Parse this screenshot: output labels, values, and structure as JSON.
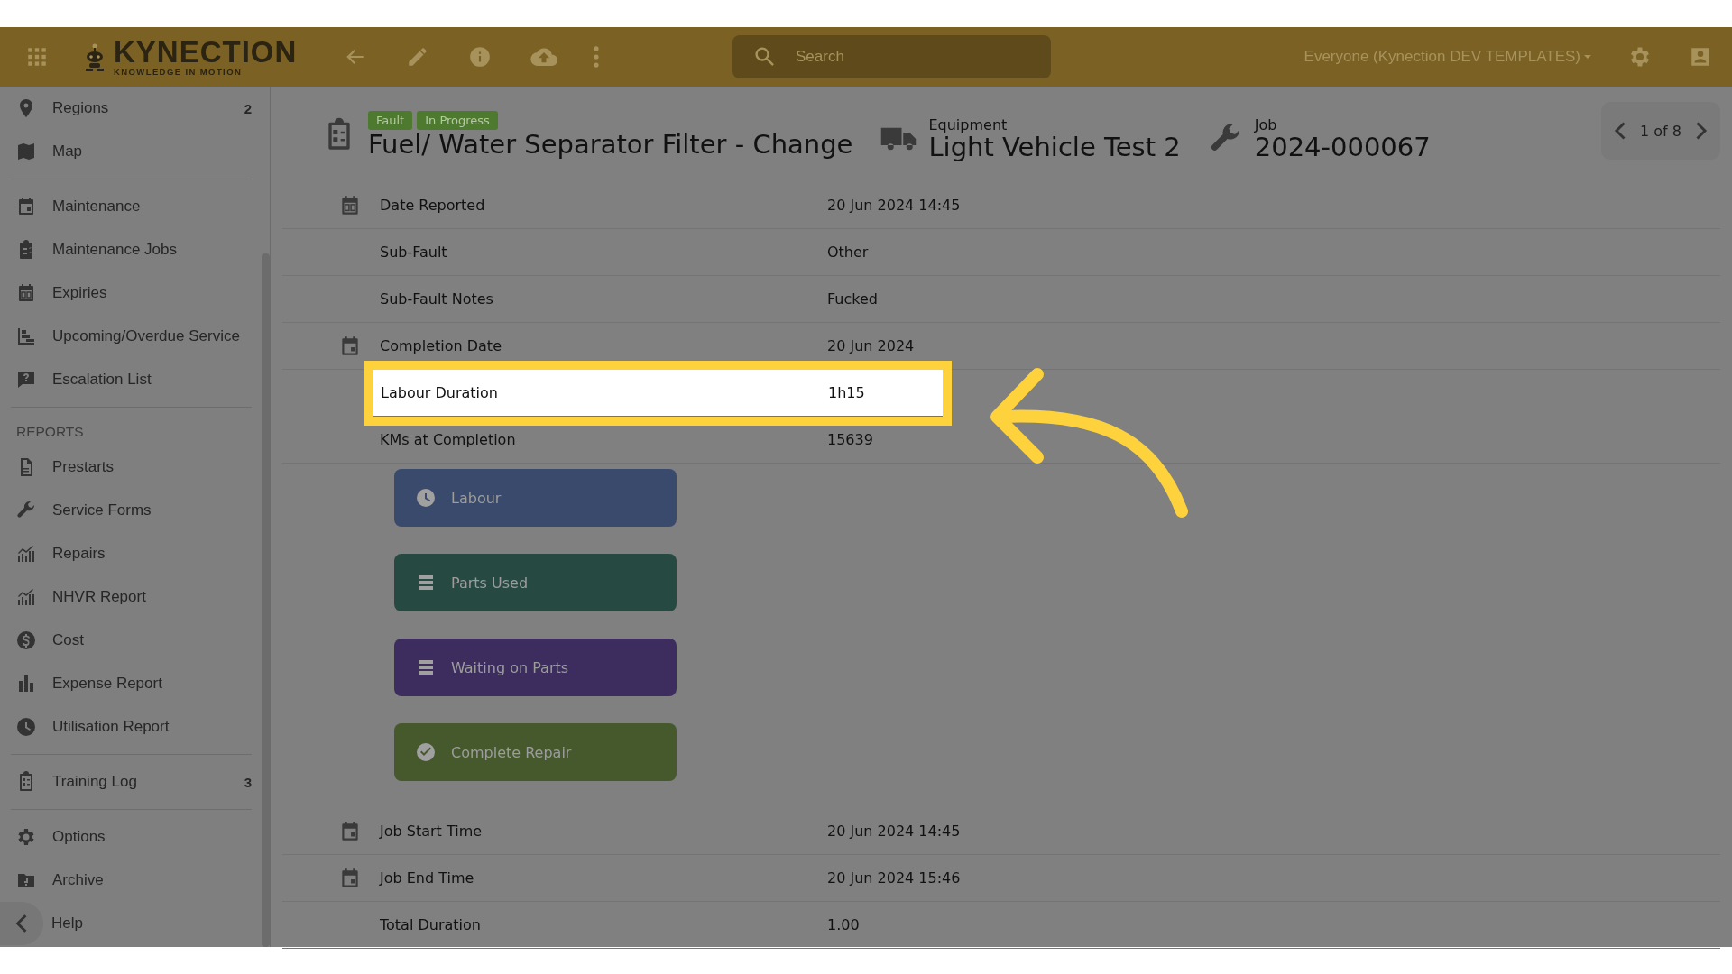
{
  "top_bar": {
    "logo": {
      "name": "KYNECTION",
      "tagline": "KNOWLEDGE IN MOTION"
    },
    "search": {
      "placeholder": "Search"
    },
    "scope": "Everyone (Kynection DEV TEMPLATES)"
  },
  "sidebar": {
    "sections": [
      {
        "items": [
          {
            "label": "Regions",
            "kind": "pin",
            "count": "2"
          },
          {
            "label": "Map",
            "kind": "map"
          }
        ]
      },
      {
        "items": [
          {
            "label": "Maintenance",
            "kind": "calendar"
          },
          {
            "label": "Maintenance Jobs",
            "kind": "clipboard"
          },
          {
            "label": "Expiries",
            "kind": "calendar30"
          },
          {
            "label": "Upcoming/Overdue Service",
            "kind": "gantt"
          },
          {
            "label": "Escalation List",
            "kind": "question"
          }
        ]
      },
      {
        "heading": "REPORTS",
        "items": [
          {
            "label": "Prestarts",
            "kind": "document"
          },
          {
            "label": "Service Forms",
            "kind": "wrench"
          },
          {
            "label": "Repairs",
            "kind": "chart"
          },
          {
            "label": "NHVR Report",
            "kind": "chart"
          },
          {
            "label": "Cost",
            "kind": "dollar"
          },
          {
            "label": "Expense Report",
            "kind": "bars"
          },
          {
            "label": "Utilisation Report",
            "kind": "clock"
          }
        ]
      },
      {
        "items": [
          {
            "label": "Training Log",
            "kind": "checklist",
            "count": "3"
          }
        ]
      },
      {
        "items": [
          {
            "label": "Options",
            "kind": "gear"
          },
          {
            "label": "Archive",
            "kind": "archive"
          },
          {
            "label": "Help",
            "kind": "collapse"
          }
        ]
      }
    ]
  },
  "header": {
    "tags": [
      "Fault",
      "In Progress"
    ],
    "title": "Fuel/ Water Separator Filter - Change",
    "equipment": {
      "label": "Equipment",
      "value": "Light Vehicle Test 2"
    },
    "job": {
      "label": "Job",
      "value": "2024-000067"
    },
    "pager": "1 of 8"
  },
  "details": [
    {
      "kind": "reported",
      "label": "Date Reported",
      "value": "20 Jun 2024 14:45",
      "highlighted": false
    },
    {
      "kind": "text",
      "label": "Sub-Fault",
      "value": "Other",
      "highlighted": false
    },
    {
      "kind": "text",
      "label": "Sub-Fault Notes",
      "value": "Fucked",
      "highlighted": false
    },
    {
      "kind": "date",
      "label": "Completion Date",
      "value": "20 Jun 2024",
      "highlighted": false
    },
    {
      "kind": "text",
      "label": "Labour Duration",
      "value": "1h15",
      "highlighted": true
    },
    {
      "kind": "text",
      "label": "KMs at Completion",
      "value": "15639",
      "highlighted": false
    },
    {
      "kind": "labour",
      "label": "Labour",
      "color": "#3a4a6c"
    },
    {
      "kind": "parts",
      "label": "Parts Used",
      "color": "#264a42"
    },
    {
      "kind": "waiting",
      "label": "Waiting on Parts",
      "color": "#3c2d5e"
    },
    {
      "kind": "complete",
      "label": "Complete Repair",
      "color": "#46592c"
    },
    {
      "kind": "date",
      "label": "Job Start Time",
      "value": "20 Jun 2024 14:45",
      "highlighted": false
    },
    {
      "kind": "date",
      "label": "Job End Time",
      "value": "20 Jun 2024 15:46",
      "highlighted": false
    },
    {
      "kind": "text",
      "label": "Total Duration",
      "value": "1.00",
      "highlighted": false
    }
  ]
}
